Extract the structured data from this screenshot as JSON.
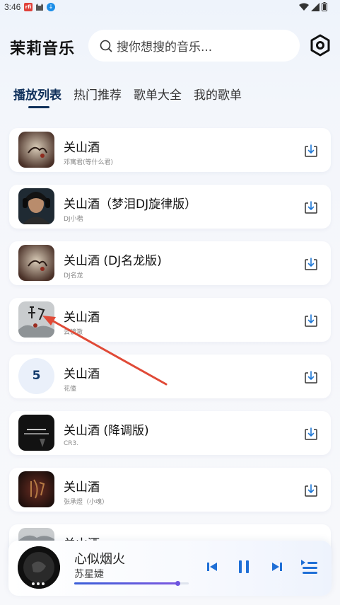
{
  "status_bar": {
    "time": "3:46",
    "badge_text": "rfi"
  },
  "header": {
    "app_title": "茉莉音乐",
    "search_placeholder": "搜你想搜的音乐..."
  },
  "tabs": [
    {
      "label": "播放列表",
      "active": true
    },
    {
      "label": "热门推荐",
      "active": false
    },
    {
      "label": "歌单大全",
      "active": false
    },
    {
      "label": "我的歌单",
      "active": false
    }
  ],
  "songs": [
    {
      "title": "关山酒",
      "artist": "邓寓君(等什么君)",
      "cover": "art"
    },
    {
      "title": "关山酒（梦泪DJ旋律版）",
      "artist": "DJ小楷",
      "cover": "portrait"
    },
    {
      "title": "关山酒 (DJ名龙版)",
      "artist": "DJ名龙",
      "cover": "art"
    },
    {
      "title": "关山酒",
      "artist": "云镜澈",
      "cover": "ink"
    },
    {
      "title": "关山酒",
      "artist": "花僮",
      "cover": "rank",
      "rank": "5"
    },
    {
      "title": "关山酒 (降调版)",
      "artist": "CR3.",
      "cover": "dark"
    },
    {
      "title": "关山酒",
      "artist": "张承煜（小魂）",
      "cover": "red"
    },
    {
      "title": "关山酒",
      "artist": "",
      "cover": "ink"
    }
  ],
  "player": {
    "title": "心似烟火",
    "artist": "苏星婕",
    "progress": 0.9
  },
  "colors": {
    "accent": "#0e2f5a",
    "control_blue": "#1f6fd6",
    "annotation_arrow": "#e04a37"
  }
}
